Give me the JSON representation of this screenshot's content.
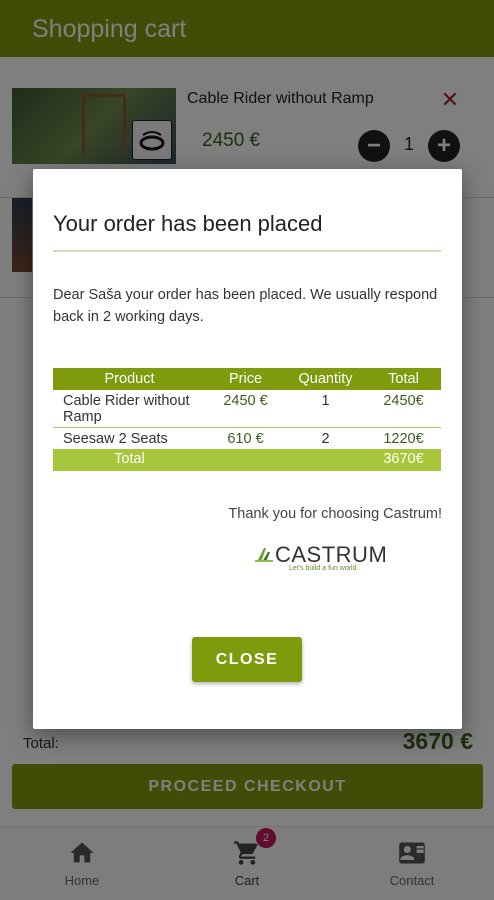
{
  "app": {
    "title": "Shopping cart",
    "colors": {
      "primary": "#7f9a0c",
      "accent_light": "#a8c63b",
      "price_green": "#3e5e1e",
      "remove_red": "#b0202a",
      "badge": "#c2185b"
    }
  },
  "cart": {
    "items": [
      {
        "name": "Cable Rider without Ramp",
        "price": "2450 €",
        "quantity": "1",
        "minus_label": "−",
        "plus_label": "+",
        "remove_label": "✕"
      },
      {
        "name": "",
        "price": "",
        "quantity": ""
      }
    ],
    "total_label": "Total:",
    "total_value": "3670 €",
    "checkout_label": "PROCEED CHECKOUT"
  },
  "bottom_nav": {
    "items": [
      {
        "label": "Home",
        "icon": "home-icon"
      },
      {
        "label": "Cart",
        "icon": "cart-icon",
        "badge": "2"
      },
      {
        "label": "Contact",
        "icon": "contact-card-icon"
      }
    ]
  },
  "dialog": {
    "title": "Your order has been placed",
    "message": "Dear Saša your order has been placed. We usually respond back in 2 working days.",
    "table": {
      "headers": [
        "Product",
        "Price",
        "Quantity",
        "Total"
      ],
      "rows": [
        {
          "product": "Cable Rider without Ramp",
          "price": "2450 €",
          "quantity": "1",
          "total": "2450€"
        },
        {
          "product": "Seesaw 2 Seats",
          "price": "610 €",
          "quantity": "2",
          "total": "1220€"
        }
      ],
      "total_label": "Total",
      "total_value": "3670€"
    },
    "thanks": "Thank you for choosing Castrum!",
    "logo": {
      "word": "CASTRUM",
      "tagline": "Let's build a fun world"
    },
    "close_label": "CLOSE"
  }
}
